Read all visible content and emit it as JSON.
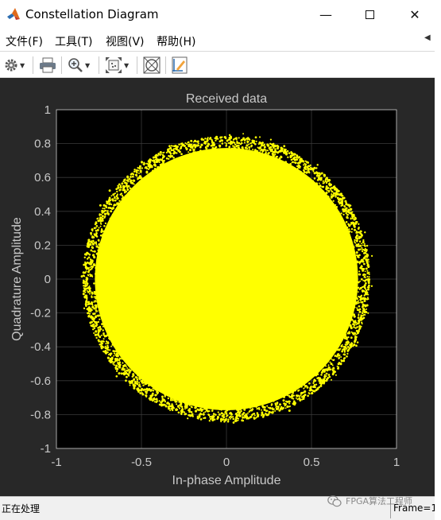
{
  "window": {
    "title": "Constellation Diagram",
    "controls": {
      "minimize": "—",
      "close": "✕"
    }
  },
  "menu": {
    "items": [
      "文件(F)",
      "工具(T)",
      "视图(V)",
      "帮助(H)"
    ],
    "overflow": "◀"
  },
  "toolbar": {
    "tools": [
      "gear-icon",
      "print-icon",
      "zoom-icon",
      "fit-to-view-icon",
      "scatter-icon",
      "measurements-icon"
    ],
    "dropdown_arrow": "▼"
  },
  "plot": {
    "background": "#000000",
    "figure_background": "#282828",
    "marker_color": "#ffff00",
    "axis_text_color": "#c8c8c8",
    "grid": true
  },
  "chart_data": {
    "type": "scatter",
    "title": "Received data",
    "xlabel": "In-phase Amplitude",
    "ylabel": "Quadrature Amplitude",
    "xlim": [
      -1,
      1
    ],
    "ylim": [
      -1,
      1
    ],
    "xticks": [
      -1,
      -0.5,
      0,
      0.5,
      1
    ],
    "xtick_labels": [
      "-1",
      "-0.5",
      "0",
      "0.5",
      "1"
    ],
    "yticks": [
      1,
      0.8,
      0.6,
      0.4,
      0.2,
      0,
      -0.2,
      -0.4,
      -0.6,
      -0.8,
      -1
    ],
    "ytick_labels": [
      "1",
      "0.8",
      "0.6",
      "0.4",
      "0.2",
      "0",
      "-0.2",
      "-0.4",
      "-0.6",
      "-0.8",
      "-1"
    ],
    "series": [
      {
        "color": "#ffff00",
        "distribution": "dense circular cloud centered at origin",
        "center": [
          0,
          0
        ],
        "radius": 0.86,
        "max_extent": 0.96
      }
    ],
    "grid": true
  },
  "status": {
    "text": "正在处理",
    "frame": "Frame=1"
  },
  "watermark": {
    "text": "FPGA算法工程师"
  }
}
